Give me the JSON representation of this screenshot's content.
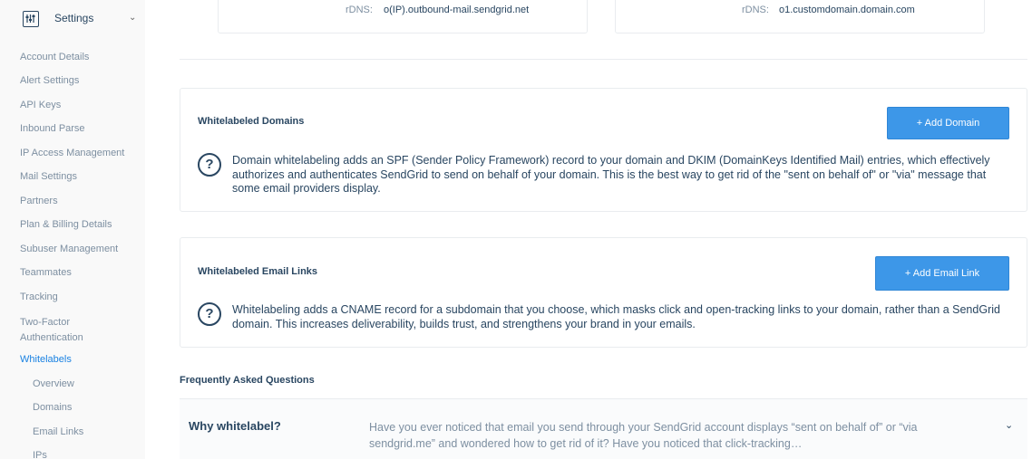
{
  "sidebar": {
    "title": "Settings",
    "icon": "sliders-icon",
    "items": [
      {
        "label": "Account Details"
      },
      {
        "label": "Alert Settings"
      },
      {
        "label": "API Keys"
      },
      {
        "label": "Inbound Parse"
      },
      {
        "label": "IP Access Management"
      },
      {
        "label": "Mail Settings"
      },
      {
        "label": "Partners"
      },
      {
        "label": "Plan & Billing Details"
      },
      {
        "label": "Subuser Management"
      },
      {
        "label": "Teammates"
      },
      {
        "label": "Tracking"
      },
      {
        "label": "Two-Factor Authentication"
      },
      {
        "label": "Whitelabels",
        "active": true
      }
    ],
    "subitems": [
      {
        "label": "Overview"
      },
      {
        "label": "Domains"
      },
      {
        "label": "Email Links"
      },
      {
        "label": "IPs"
      }
    ]
  },
  "rdns": {
    "left": {
      "label": "rDNS:",
      "value": "o(IP).outbound-mail.sendgrid.net"
    },
    "right": {
      "label": "rDNS:",
      "value": "o1.customdomain.domain.com"
    }
  },
  "domains": {
    "title": "Whitelabeled Domains",
    "button": "+ Add Domain",
    "description": "Domain whitelabeling adds an SPF (Sender Policy Framework) record to your domain and DKIM (DomainKeys Identified Mail) entries, which effectively authorizes and authenticates SendGrid to send on behalf of your domain. This is the best way to get rid of the \"sent on behalf of\" or \"via\" message that some email providers display."
  },
  "email_links": {
    "title": "Whitelabeled Email Links",
    "button": "+ Add Email Link",
    "description": "Whitelabeling adds a CNAME record for a subdomain that you choose, which masks click and open-tracking links to your domain, rather than a SendGrid domain. This increases deliverability, builds trust, and strengthens your brand in your emails."
  },
  "help_glyph": "?",
  "faq": {
    "heading": "Frequently Asked Questions",
    "items": [
      {
        "question": "Why whitelabel?",
        "answer": "Have you ever noticed that email you send through your SendGrid account displays “sent on behalf of” or “via sendgrid.me” and wondered how to get rid of it? Have you noticed that click-tracking…"
      }
    ]
  },
  "colors": {
    "accent": "#1a82e2",
    "button": "#3d97e8",
    "text": "#294661",
    "muted": "#7d8fa1"
  }
}
